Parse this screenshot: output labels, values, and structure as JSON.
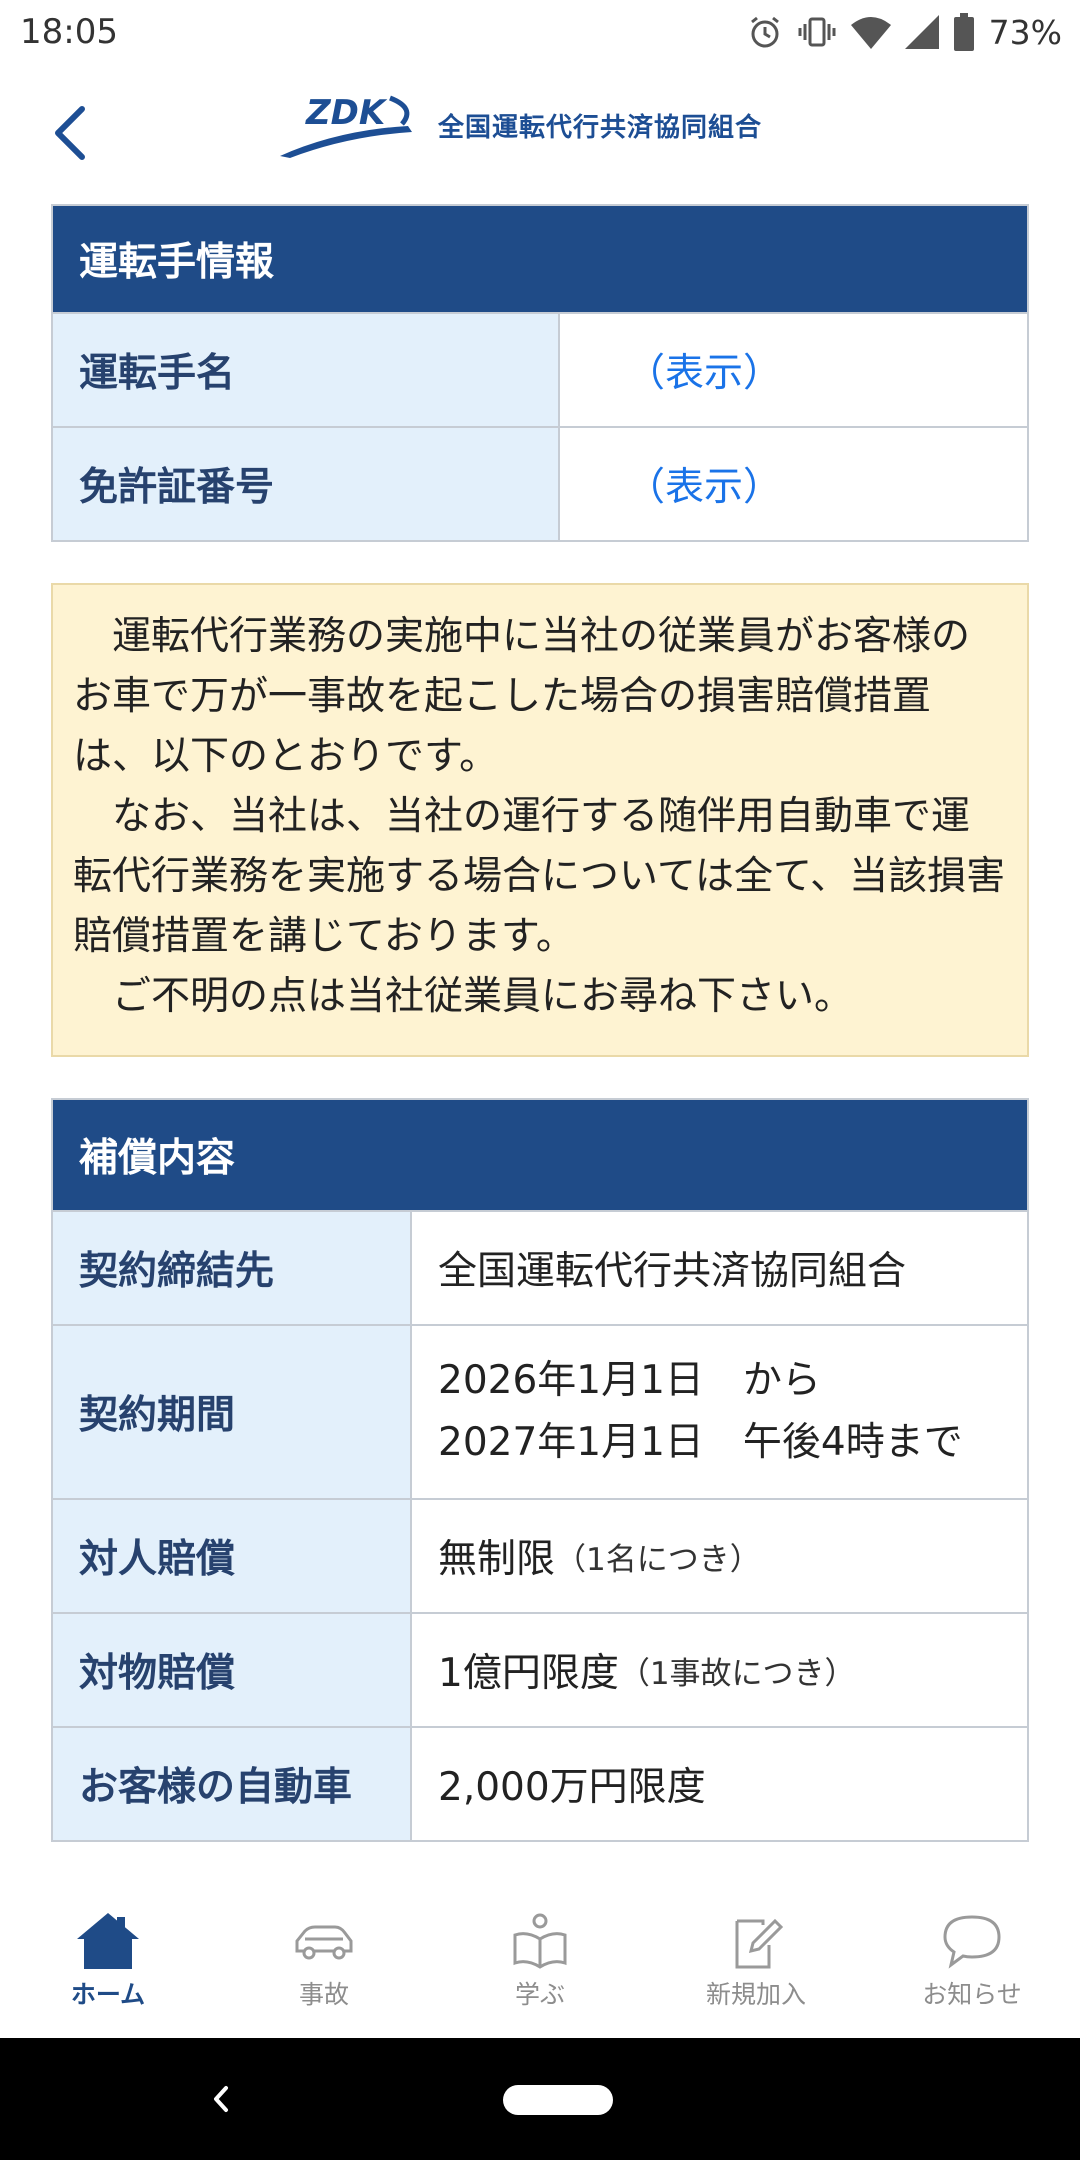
{
  "status_bar": {
    "time": "18:05",
    "battery_percent": "73%",
    "icons": [
      "alarm-icon",
      "vibrate-icon",
      "wifi-icon",
      "signal-icon",
      "battery-icon"
    ]
  },
  "header": {
    "logo_text": "ZDK",
    "org_name": "全国運転代行共済協同組合"
  },
  "driver_info": {
    "title": "運転手情報",
    "rows": [
      {
        "label": "運転手名",
        "value": "（表示）"
      },
      {
        "label": "免許証番号",
        "value": "（表示）"
      }
    ]
  },
  "notice": {
    "paragraphs": [
      "運転代行業務の実施中に当社の従業員がお客様のお車で万が一事故を起こした場合の損害賠償措置は、以下のとおりです。",
      "なお、当社は、当社の運行する随伴用自動車で運転代行業務を実施する場合については全て、当該損害賠償措置を講じております。",
      "ご不明の点は当社従業員にお尋ね下さい。"
    ]
  },
  "coverage": {
    "title": "補償内容",
    "rows": [
      {
        "label": "契約締結先",
        "value": "全国運転代行共済協同組合",
        "note": ""
      },
      {
        "label": "契約期間",
        "value_line1": "2026年1月1日　から",
        "value_line2": "2027年1月1日　午後4時まで"
      },
      {
        "label": "対人賠償",
        "value": "無制限",
        "note": "（1名につき）"
      },
      {
        "label": "対物賠償",
        "value": "1億円限度",
        "note": "（1事故につき）"
      },
      {
        "label": "お客様の自動車",
        "value": "2,000万円限度",
        "note": ""
      }
    ]
  },
  "bottom_nav": {
    "items": [
      {
        "label": "ホーム",
        "icon": "home-icon",
        "active": true
      },
      {
        "label": "事故",
        "icon": "car-icon",
        "active": false
      },
      {
        "label": "学ぶ",
        "icon": "book-icon",
        "active": false
      },
      {
        "label": "新規加入",
        "icon": "edit-document-icon",
        "active": false
      },
      {
        "label": "お知らせ",
        "icon": "speech-bubble-icon",
        "active": false
      }
    ]
  },
  "colors": {
    "primary": "#1f4b87",
    "label_bg": "#e3f0fb",
    "notice_bg": "#fef3d2",
    "link": "#1a73e8"
  }
}
